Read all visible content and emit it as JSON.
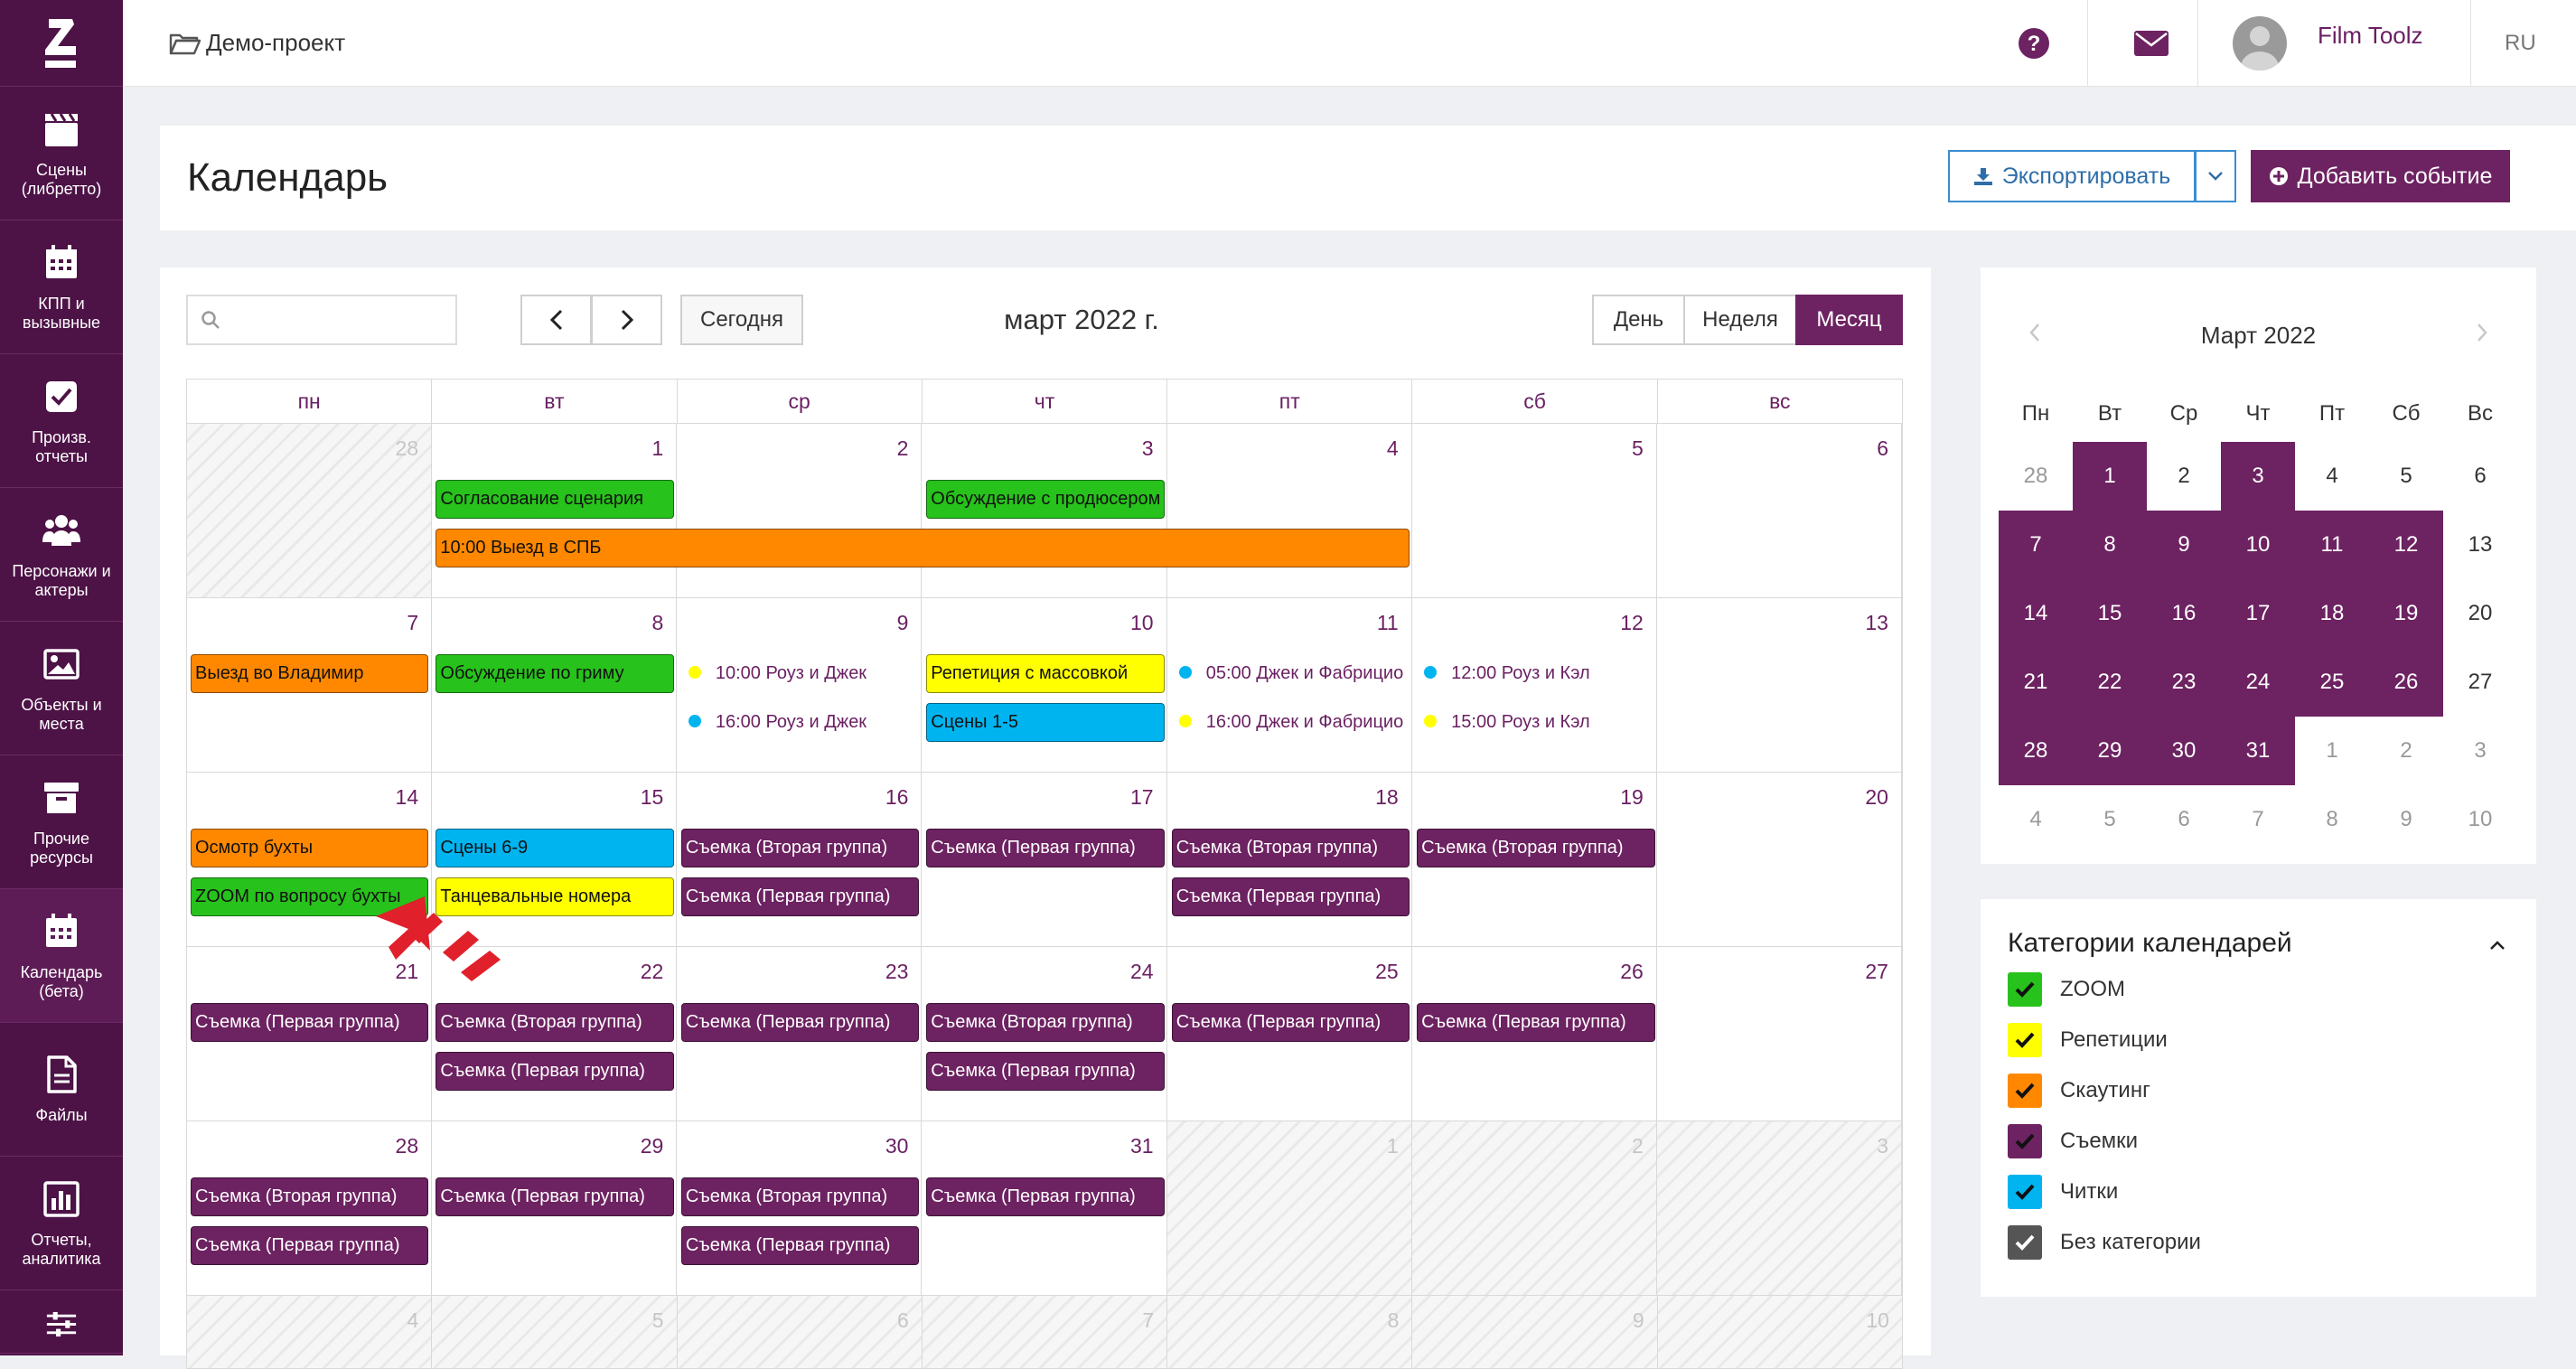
{
  "sidebar": {
    "items": [
      {
        "label_1": "Сцены",
        "label_2": "(либретто)",
        "icon": "clapperboard-icon"
      },
      {
        "label_1": "КПП и",
        "label_2": "вызывные",
        "icon": "calendar-grid-icon"
      },
      {
        "label_1": "Произв. отчеты",
        "label_2": "",
        "icon": "checkbox-icon"
      },
      {
        "label_1": "Персонажи и",
        "label_2": "актеры",
        "icon": "people-icon"
      },
      {
        "label_1": "Объекты и",
        "label_2": "места",
        "icon": "image-icon"
      },
      {
        "label_1": "Прочие",
        "label_2": "ресурсы",
        "icon": "archive-icon"
      },
      {
        "label_1": "Календарь",
        "label_2": "(бета)",
        "icon": "calendar-icon",
        "active": true
      },
      {
        "label_1": "Файлы",
        "label_2": "",
        "icon": "file-icon"
      },
      {
        "label_1": "Отчеты,",
        "label_2": "аналитика",
        "icon": "bar-chart-icon"
      },
      {
        "label_1": "",
        "label_2": "",
        "icon": "sliders-icon"
      }
    ]
  },
  "topbar": {
    "project": "Демо-проект",
    "user_name": "Film Toolz",
    "lang": "RU"
  },
  "header": {
    "title": "Календарь",
    "export_label": "Экспортировать",
    "add_event_label": "Добавить событие"
  },
  "calendar": {
    "search_placeholder": "",
    "today_label": "Сегодня",
    "month_title": "март 2022 г.",
    "views": {
      "day": "День",
      "week": "Неделя",
      "month": "Месяц"
    },
    "dow": [
      "пн",
      "вт",
      "ср",
      "чт",
      "пт",
      "сб",
      "вс"
    ],
    "weeks": [
      {
        "days": [
          "28",
          "1",
          "2",
          "3",
          "4",
          "5",
          "6"
        ],
        "other": [
          0
        ]
      },
      {
        "days": [
          "7",
          "8",
          "9",
          "10",
          "11",
          "12",
          "13"
        ],
        "other": []
      },
      {
        "days": [
          "14",
          "15",
          "16",
          "17",
          "18",
          "19",
          "20"
        ],
        "other": []
      },
      {
        "days": [
          "21",
          "22",
          "23",
          "24",
          "25",
          "26",
          "27"
        ],
        "other": []
      },
      {
        "days": [
          "28",
          "29",
          "30",
          "31",
          "1",
          "2",
          "3"
        ],
        "other": [
          4,
          5,
          6
        ]
      },
      {
        "days": [
          "4",
          "5",
          "6",
          "7",
          "8",
          "9",
          "10"
        ],
        "other": [
          0,
          1,
          2,
          3,
          4,
          5,
          6
        ]
      }
    ],
    "events": [
      {
        "week": 0,
        "col": 1,
        "span": 1,
        "row": 0,
        "text": "Согласование сценария",
        "cat": "zoom"
      },
      {
        "week": 0,
        "col": 3,
        "span": 1,
        "row": 0,
        "text": "Обсуждение с продюсером",
        "cat": "zoom"
      },
      {
        "week": 0,
        "col": 1,
        "span": 4,
        "row": 1,
        "text": "10:00  Выезд в СПБ",
        "cat": "scout"
      },
      {
        "week": 1,
        "col": 0,
        "span": 1,
        "row": 0,
        "text": "Выезд во Владимир",
        "cat": "scout"
      },
      {
        "week": 1,
        "col": 1,
        "span": 1,
        "row": 0,
        "text": "Обсуждение по гриму",
        "cat": "zoom"
      },
      {
        "week": 1,
        "col": 2,
        "span": 1,
        "row": 0,
        "text": "10:00 Роуз и Джек",
        "cat": "rehearsal",
        "dot": true
      },
      {
        "week": 1,
        "col": 2,
        "span": 1,
        "row": 1,
        "text": "16:00 Роуз и Джек",
        "cat": "reading",
        "dot": true
      },
      {
        "week": 1,
        "col": 3,
        "span": 1,
        "row": 0,
        "text": "Репетиция с массовкой",
        "cat": "rehearsal"
      },
      {
        "week": 1,
        "col": 3,
        "span": 1,
        "row": 1,
        "text": "Сцены 1-5",
        "cat": "reading"
      },
      {
        "week": 1,
        "col": 4,
        "span": 1,
        "row": 0,
        "text": "05:00 Джек и Фабрицио",
        "cat": "reading",
        "dot": true
      },
      {
        "week": 1,
        "col": 4,
        "span": 1,
        "row": 1,
        "text": "16:00 Джек и Фабрицио",
        "cat": "rehearsal",
        "dot": true
      },
      {
        "week": 1,
        "col": 5,
        "span": 1,
        "row": 0,
        "text": "12:00 Роуз и Кэл",
        "cat": "reading",
        "dot": true
      },
      {
        "week": 1,
        "col": 5,
        "span": 1,
        "row": 1,
        "text": "15:00 Роуз и Кэл",
        "cat": "rehearsal",
        "dot": true
      },
      {
        "week": 2,
        "col": 0,
        "span": 1,
        "row": 0,
        "text": "Осмотр бухты",
        "cat": "scout"
      },
      {
        "week": 2,
        "col": 0,
        "span": 1,
        "row": 1,
        "text": "ZOOM по вопросу бухты",
        "cat": "zoom"
      },
      {
        "week": 2,
        "col": 1,
        "span": 1,
        "row": 0,
        "text": "Сцены 6-9",
        "cat": "reading"
      },
      {
        "week": 2,
        "col": 1,
        "span": 1,
        "row": 1,
        "text": "Танцевальные номера",
        "cat": "rehearsal"
      },
      {
        "week": 2,
        "col": 2,
        "span": 1,
        "row": 0,
        "text": "Съемка (Вторая группа)",
        "cat": "shoot"
      },
      {
        "week": 2,
        "col": 2,
        "span": 1,
        "row": 1,
        "text": "Съемка (Первая группа)",
        "cat": "shoot"
      },
      {
        "week": 2,
        "col": 3,
        "span": 1,
        "row": 0,
        "text": "Съемка (Первая группа)",
        "cat": "shoot"
      },
      {
        "week": 2,
        "col": 4,
        "span": 1,
        "row": 0,
        "text": "Съемка (Вторая группа)",
        "cat": "shoot"
      },
      {
        "week": 2,
        "col": 4,
        "span": 1,
        "row": 1,
        "text": "Съемка (Первая группа)",
        "cat": "shoot"
      },
      {
        "week": 2,
        "col": 5,
        "span": 1,
        "row": 0,
        "text": "Съемка (Вторая группа)",
        "cat": "shoot"
      },
      {
        "week": 3,
        "col": 0,
        "span": 1,
        "row": 0,
        "text": "Съемка (Первая группа)",
        "cat": "shoot"
      },
      {
        "week": 3,
        "col": 1,
        "span": 1,
        "row": 0,
        "text": "Съемка (Вторая группа)",
        "cat": "shoot"
      },
      {
        "week": 3,
        "col": 1,
        "span": 1,
        "row": 1,
        "text": "Съемка (Первая группа)",
        "cat": "shoot"
      },
      {
        "week": 3,
        "col": 2,
        "span": 1,
        "row": 0,
        "text": "Съемка (Первая группа)",
        "cat": "shoot"
      },
      {
        "week": 3,
        "col": 3,
        "span": 1,
        "row": 0,
        "text": "Съемка (Вторая группа)",
        "cat": "shoot"
      },
      {
        "week": 3,
        "col": 3,
        "span": 1,
        "row": 1,
        "text": "Съемка (Первая группа)",
        "cat": "shoot"
      },
      {
        "week": 3,
        "col": 4,
        "span": 1,
        "row": 0,
        "text": "Съемка (Первая группа)",
        "cat": "shoot"
      },
      {
        "week": 3,
        "col": 5,
        "span": 1,
        "row": 0,
        "text": "Съемка (Первая группа)",
        "cat": "shoot"
      },
      {
        "week": 4,
        "col": 0,
        "span": 1,
        "row": 0,
        "text": "Съемка (Вторая группа)",
        "cat": "shoot"
      },
      {
        "week": 4,
        "col": 0,
        "span": 1,
        "row": 1,
        "text": "Съемка (Первая группа)",
        "cat": "shoot"
      },
      {
        "week": 4,
        "col": 1,
        "span": 1,
        "row": 0,
        "text": "Съемка (Первая группа)",
        "cat": "shoot"
      },
      {
        "week": 4,
        "col": 2,
        "span": 1,
        "row": 0,
        "text": "Съемка (Вторая группа)",
        "cat": "shoot"
      },
      {
        "week": 4,
        "col": 2,
        "span": 1,
        "row": 1,
        "text": "Съемка (Первая группа)",
        "cat": "shoot"
      },
      {
        "week": 4,
        "col": 3,
        "span": 1,
        "row": 0,
        "text": "Съемка (Первая группа)",
        "cat": "shoot"
      }
    ]
  },
  "category_colors": {
    "zoom": "#27c21b",
    "rehearsal": "#ffff00",
    "scout": "#ff8800",
    "shoot": "#6d2261",
    "reading": "#00b4f0",
    "none": "#555555"
  },
  "mini": {
    "title": "Март 2022",
    "dow": [
      "Пн",
      "Вт",
      "Ср",
      "Чт",
      "Пт",
      "Сб",
      "Вс"
    ],
    "rows": [
      [
        "28",
        "1",
        "2",
        "3",
        "4",
        "5",
        "6"
      ],
      [
        "7",
        "8",
        "9",
        "10",
        "11",
        "12",
        "13"
      ],
      [
        "14",
        "15",
        "16",
        "17",
        "18",
        "19",
        "20"
      ],
      [
        "21",
        "22",
        "23",
        "24",
        "25",
        "26",
        "27"
      ],
      [
        "28",
        "29",
        "30",
        "31",
        "1",
        "2",
        "3"
      ],
      [
        "4",
        "5",
        "6",
        "7",
        "8",
        "9",
        "10"
      ]
    ],
    "muted": [
      [
        0,
        0
      ],
      [
        4,
        4
      ],
      [
        4,
        5
      ],
      [
        4,
        6
      ],
      [
        5,
        0
      ],
      [
        5,
        1
      ],
      [
        5,
        2
      ],
      [
        5,
        3
      ],
      [
        5,
        4
      ],
      [
        5,
        5
      ],
      [
        5,
        6
      ]
    ],
    "selected": [
      [
        0,
        1
      ],
      [
        0,
        3
      ],
      [
        1,
        0
      ],
      [
        1,
        1
      ],
      [
        1,
        2
      ],
      [
        1,
        3
      ],
      [
        1,
        4
      ],
      [
        1,
        5
      ],
      [
        2,
        0
      ],
      [
        2,
        1
      ],
      [
        2,
        2
      ],
      [
        2,
        3
      ],
      [
        2,
        4
      ],
      [
        2,
        5
      ],
      [
        3,
        0
      ],
      [
        3,
        1
      ],
      [
        3,
        2
      ],
      [
        3,
        3
      ],
      [
        3,
        4
      ],
      [
        3,
        5
      ],
      [
        4,
        0
      ],
      [
        4,
        1
      ],
      [
        4,
        2
      ],
      [
        4,
        3
      ]
    ]
  },
  "categories": {
    "title": "Категории календарей",
    "items": [
      {
        "label": "ZOOM",
        "color": "#27c21b"
      },
      {
        "label": "Репетиции",
        "color": "#ffff00"
      },
      {
        "label": "Скаутинг",
        "color": "#ff8800"
      },
      {
        "label": "Съемки",
        "color": "#6d2261"
      },
      {
        "label": "Читки",
        "color": "#00b4f0"
      },
      {
        "label": "Без категории",
        "color": "#555555"
      }
    ]
  }
}
